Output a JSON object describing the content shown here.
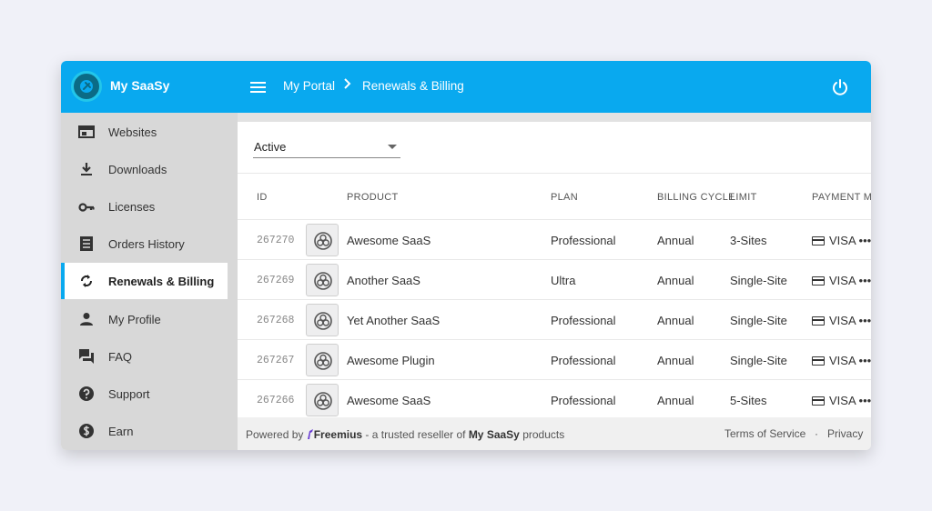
{
  "app": {
    "title": "My SaaSy"
  },
  "breadcrumb": {
    "home": "My Portal",
    "current": "Renewals & Billing"
  },
  "sidebar": {
    "items": [
      {
        "label": "Websites",
        "icon": "web-icon"
      },
      {
        "label": "Downloads",
        "icon": "download-icon"
      },
      {
        "label": "Licenses",
        "icon": "key-icon"
      },
      {
        "label": "Orders History",
        "icon": "receipt-icon"
      },
      {
        "label": "Renewals & Billing",
        "icon": "sync-icon",
        "active": true
      },
      {
        "label": "My Profile",
        "icon": "person-icon"
      },
      {
        "label": "FAQ",
        "icon": "chat-icon"
      },
      {
        "label": "Support",
        "icon": "help-icon"
      },
      {
        "label": "Earn",
        "icon": "dollar-icon"
      }
    ]
  },
  "filter": {
    "value": "Active"
  },
  "table": {
    "columns": [
      "ID",
      "PRODUCT",
      "PLAN",
      "BILLING CYCLE",
      "LIMIT",
      "PAYMENT ME"
    ],
    "rows": [
      {
        "id": "267270",
        "product": "Awesome SaaS",
        "plan": "Professional",
        "cycle": "Annual",
        "limit": "3-Sites",
        "payment": "VISA •••"
      },
      {
        "id": "267269",
        "product": "Another SaaS",
        "plan": "Ultra",
        "cycle": "Annual",
        "limit": "Single-Site",
        "payment": "VISA •••"
      },
      {
        "id": "267268",
        "product": "Yet Another SaaS",
        "plan": "Professional",
        "cycle": "Annual",
        "limit": "Single-Site",
        "payment": "VISA •••"
      },
      {
        "id": "267267",
        "product": "Awesome Plugin",
        "plan": "Professional",
        "cycle": "Annual",
        "limit": "Single-Site",
        "payment": "VISA •••"
      },
      {
        "id": "267266",
        "product": "Awesome SaaS",
        "plan": "Professional",
        "cycle": "Annual",
        "limit": "5-Sites",
        "payment": "VISA •••"
      }
    ]
  },
  "footer": {
    "powered_by": "Powered by",
    "brand": "Freemius",
    "middle": "- a trusted reseller of",
    "company": "My SaaSy",
    "suffix": "products",
    "terms": "Terms of Service",
    "separator": "·",
    "privacy": "Privacy"
  },
  "colors": {
    "accent": "#09a9ef",
    "sidebar_bg": "#d8d8d8",
    "brand_purple": "#6b3fd4"
  }
}
